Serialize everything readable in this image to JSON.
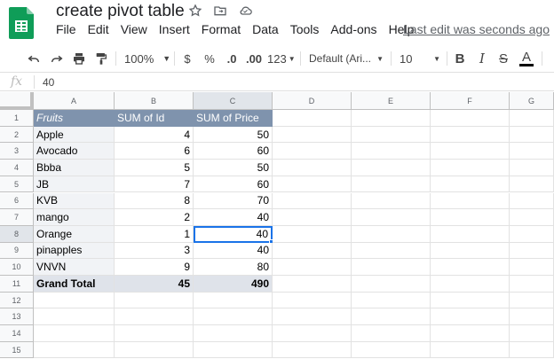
{
  "app": {
    "title": "create pivot  table",
    "last_edit": "Last edit was seconds ago",
    "brand_color": "#0f9d58"
  },
  "menu": [
    "File",
    "Edit",
    "View",
    "Insert",
    "Format",
    "Data",
    "Tools",
    "Add-ons",
    "Help"
  ],
  "toolbar": {
    "zoom": "100%",
    "currency": "$",
    "percent": "%",
    "decrease_decimal": ".0",
    "increase_decimal": ".00",
    "more_formats": "123",
    "font": "Default (Ari...",
    "font_size": "10",
    "bold": "B",
    "italic": "I",
    "strike": "S",
    "text_color": "A"
  },
  "formula_bar": {
    "fx": "fx",
    "value": "40"
  },
  "columns": [
    "A",
    "B",
    "C",
    "D",
    "E",
    "F",
    "G"
  ],
  "rows": [
    "1",
    "2",
    "3",
    "4",
    "5",
    "6",
    "7",
    "8",
    "9",
    "10",
    "11",
    "12",
    "13",
    "14",
    "15"
  ],
  "pivot": {
    "header": [
      "Fruits",
      "SUM of Id",
      "SUM of Price"
    ],
    "data": [
      [
        "Apple",
        "4",
        "50"
      ],
      [
        "Avocado",
        "6",
        "60"
      ],
      [
        "Bbba",
        "5",
        "50"
      ],
      [
        "JB",
        "7",
        "60"
      ],
      [
        "KVB",
        "8",
        "70"
      ],
      [
        "mango",
        "2",
        "40"
      ],
      [
        "Orange",
        "1",
        "40"
      ],
      [
        "pinapples",
        "3",
        "40"
      ],
      [
        "VNVN",
        "9",
        "80"
      ]
    ],
    "total": [
      "Grand Total",
      "45",
      "490"
    ]
  },
  "colors": {
    "header_bg": "#7f93ad",
    "selection": "#1a73e8"
  }
}
